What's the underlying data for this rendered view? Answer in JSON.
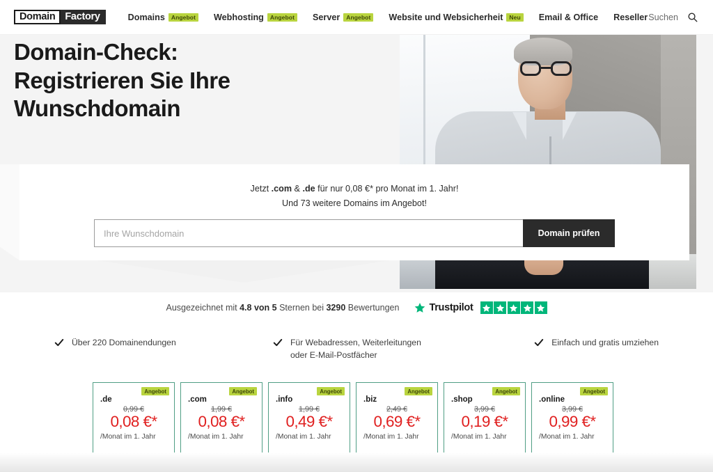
{
  "header": {
    "logo": {
      "part1": "Domain",
      "part2": "Factory"
    },
    "nav": [
      {
        "label": "Domains",
        "badge": "Angebot"
      },
      {
        "label": "Webhosting",
        "badge": "Angebot"
      },
      {
        "label": "Server",
        "badge": "Angebot"
      },
      {
        "label": "Website und Websicherheit",
        "badge": "Neu"
      },
      {
        "label": "Email & Office",
        "badge": ""
      },
      {
        "label": "Reseller",
        "badge": ""
      }
    ],
    "search_label": "Suchen",
    "search_icon": "search-icon"
  },
  "hero": {
    "title": "Domain-Check:\nRegistrieren Sie Ihre\nWunschdomain",
    "promo_line1_pre": "Jetzt ",
    "promo_line1_b1": ".com",
    "promo_line1_mid": " & ",
    "promo_line1_b2": ".de",
    "promo_line1_post": " für nur 0,08 €* pro Monat im 1. Jahr!",
    "promo_line2": "Und 73 weitere Domains im Angebot!",
    "input_placeholder": "Ihre Wunschdomain",
    "input_value": "",
    "check_button": "Domain prüfen"
  },
  "rating": {
    "prefix": "Ausgezeichnet mit ",
    "score": "4.8 von 5",
    "middle": " Sternen bei ",
    "count": "3290",
    "suffix": " Bewertungen",
    "trustpilot_name": "Trustpilot",
    "stars": 5,
    "star_color": "#00b67a"
  },
  "features": [
    {
      "icon": "check-icon",
      "text": "Über 220 Domainendungen"
    },
    {
      "icon": "check-icon",
      "text": "Für Webadressen, Weiterleitungen oder E-Mail-Postfächer"
    },
    {
      "icon": "check-icon",
      "text": "Einfach und gratis umziehen"
    }
  ],
  "price_cards": [
    {
      "tld": ".de",
      "badge": "Angebot",
      "old_price": "0,99 €",
      "new_price": "0,08 €*",
      "period": "/Monat im 1. Jahr"
    },
    {
      "tld": ".com",
      "badge": "Angebot",
      "old_price": "1,99 €",
      "new_price": "0,08 €*",
      "period": "/Monat im 1. Jahr"
    },
    {
      "tld": ".info",
      "badge": "Angebot",
      "old_price": "1,99 €",
      "new_price": "0,49 €*",
      "period": "/Monat im 1. Jahr"
    },
    {
      "tld": ".biz",
      "badge": "Angebot",
      "old_price": "2,49 €",
      "new_price": "0,69 €*",
      "period": "/Monat im 1. Jahr"
    },
    {
      "tld": ".shop",
      "badge": "Angebot",
      "old_price": "3,99 €",
      "new_price": "0,19 €*",
      "period": "/Monat im 1. Jahr"
    },
    {
      "tld": ".online",
      "badge": "Angebot",
      "old_price": "3,99 €",
      "new_price": "0,99 €*",
      "period": "/Monat im 1. Jahr"
    }
  ],
  "colors": {
    "badge_green": "#b9d43f",
    "price_red": "#e02020",
    "card_border": "#4f9e84",
    "trustpilot_green": "#00b67a",
    "dark": "#2b2b2b"
  }
}
